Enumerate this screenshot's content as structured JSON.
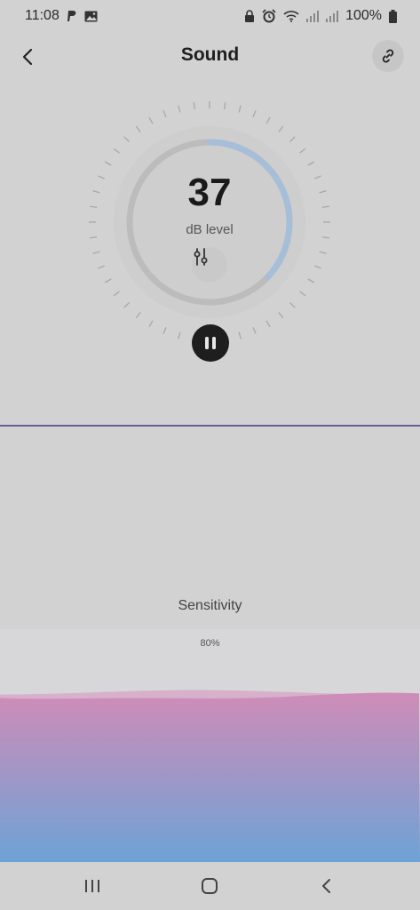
{
  "status_bar": {
    "time": "11:08",
    "battery": "100%",
    "icons_left": [
      "paypal-icon",
      "image-icon"
    ],
    "icons_right": [
      "lock-icon",
      "alarm-icon",
      "wifi-icon",
      "signal-icon",
      "signal-icon",
      "battery-icon"
    ]
  },
  "header": {
    "title": "Sound",
    "back_icon": "back-arrow-icon",
    "link_icon": "link-icon"
  },
  "meter": {
    "value": "37",
    "label": "dB level",
    "arc_fraction": 0.37,
    "arc_color": "#a6bed8",
    "track_color": "#bcbcbc",
    "eq_icon": "equalizer-icon"
  },
  "controls": {
    "pause_icon": "pause-icon"
  },
  "sensitivity": {
    "label": "Sensitivity",
    "value_text": "80%",
    "value": 0.8,
    "gradient_top": "#cf8cb8",
    "gradient_bottom": "#6ea2d6"
  },
  "nav_bar": {
    "icons": [
      "recent-apps-icon",
      "home-icon",
      "back-icon"
    ]
  },
  "colors": {
    "background": "#d2d2d2",
    "divider": "#6a5a96"
  }
}
